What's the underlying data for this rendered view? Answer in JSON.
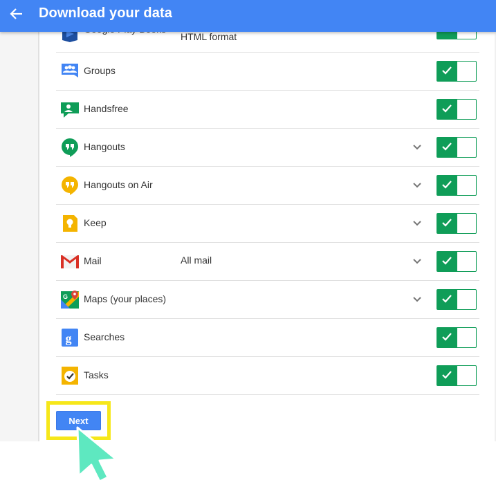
{
  "header": {
    "title": "Download your data"
  },
  "rows": [
    {
      "label": "Google Play Books",
      "format": "HTML format",
      "chevron": false
    },
    {
      "label": "Groups",
      "format": "",
      "chevron": false
    },
    {
      "label": "Handsfree",
      "format": "",
      "chevron": false
    },
    {
      "label": "Hangouts",
      "format": "",
      "chevron": true
    },
    {
      "label": "Hangouts on Air",
      "format": "",
      "chevron": true
    },
    {
      "label": "Keep",
      "format": "",
      "chevron": true
    },
    {
      "label": "Mail",
      "format": "All mail",
      "chevron": true
    },
    {
      "label": "Maps (your places)",
      "format": "",
      "chevron": true
    },
    {
      "label": "Searches",
      "format": "",
      "chevron": false
    },
    {
      "label": "Tasks",
      "format": "",
      "chevron": false
    }
  ],
  "icons": [
    "play-books-icon",
    "groups-icon",
    "handsfree-icon",
    "hangouts-icon",
    "hangouts-on-air-icon",
    "keep-icon",
    "mail-icon",
    "maps-icon",
    "searches-icon",
    "tasks-icon"
  ],
  "toggles_on": true,
  "next_button": {
    "label": "Next"
  },
  "colors": {
    "accent": "#4285f4",
    "toggle_on": "#0f9d58",
    "highlight": "#f6e71a",
    "cursor": "#5ee8c0"
  }
}
